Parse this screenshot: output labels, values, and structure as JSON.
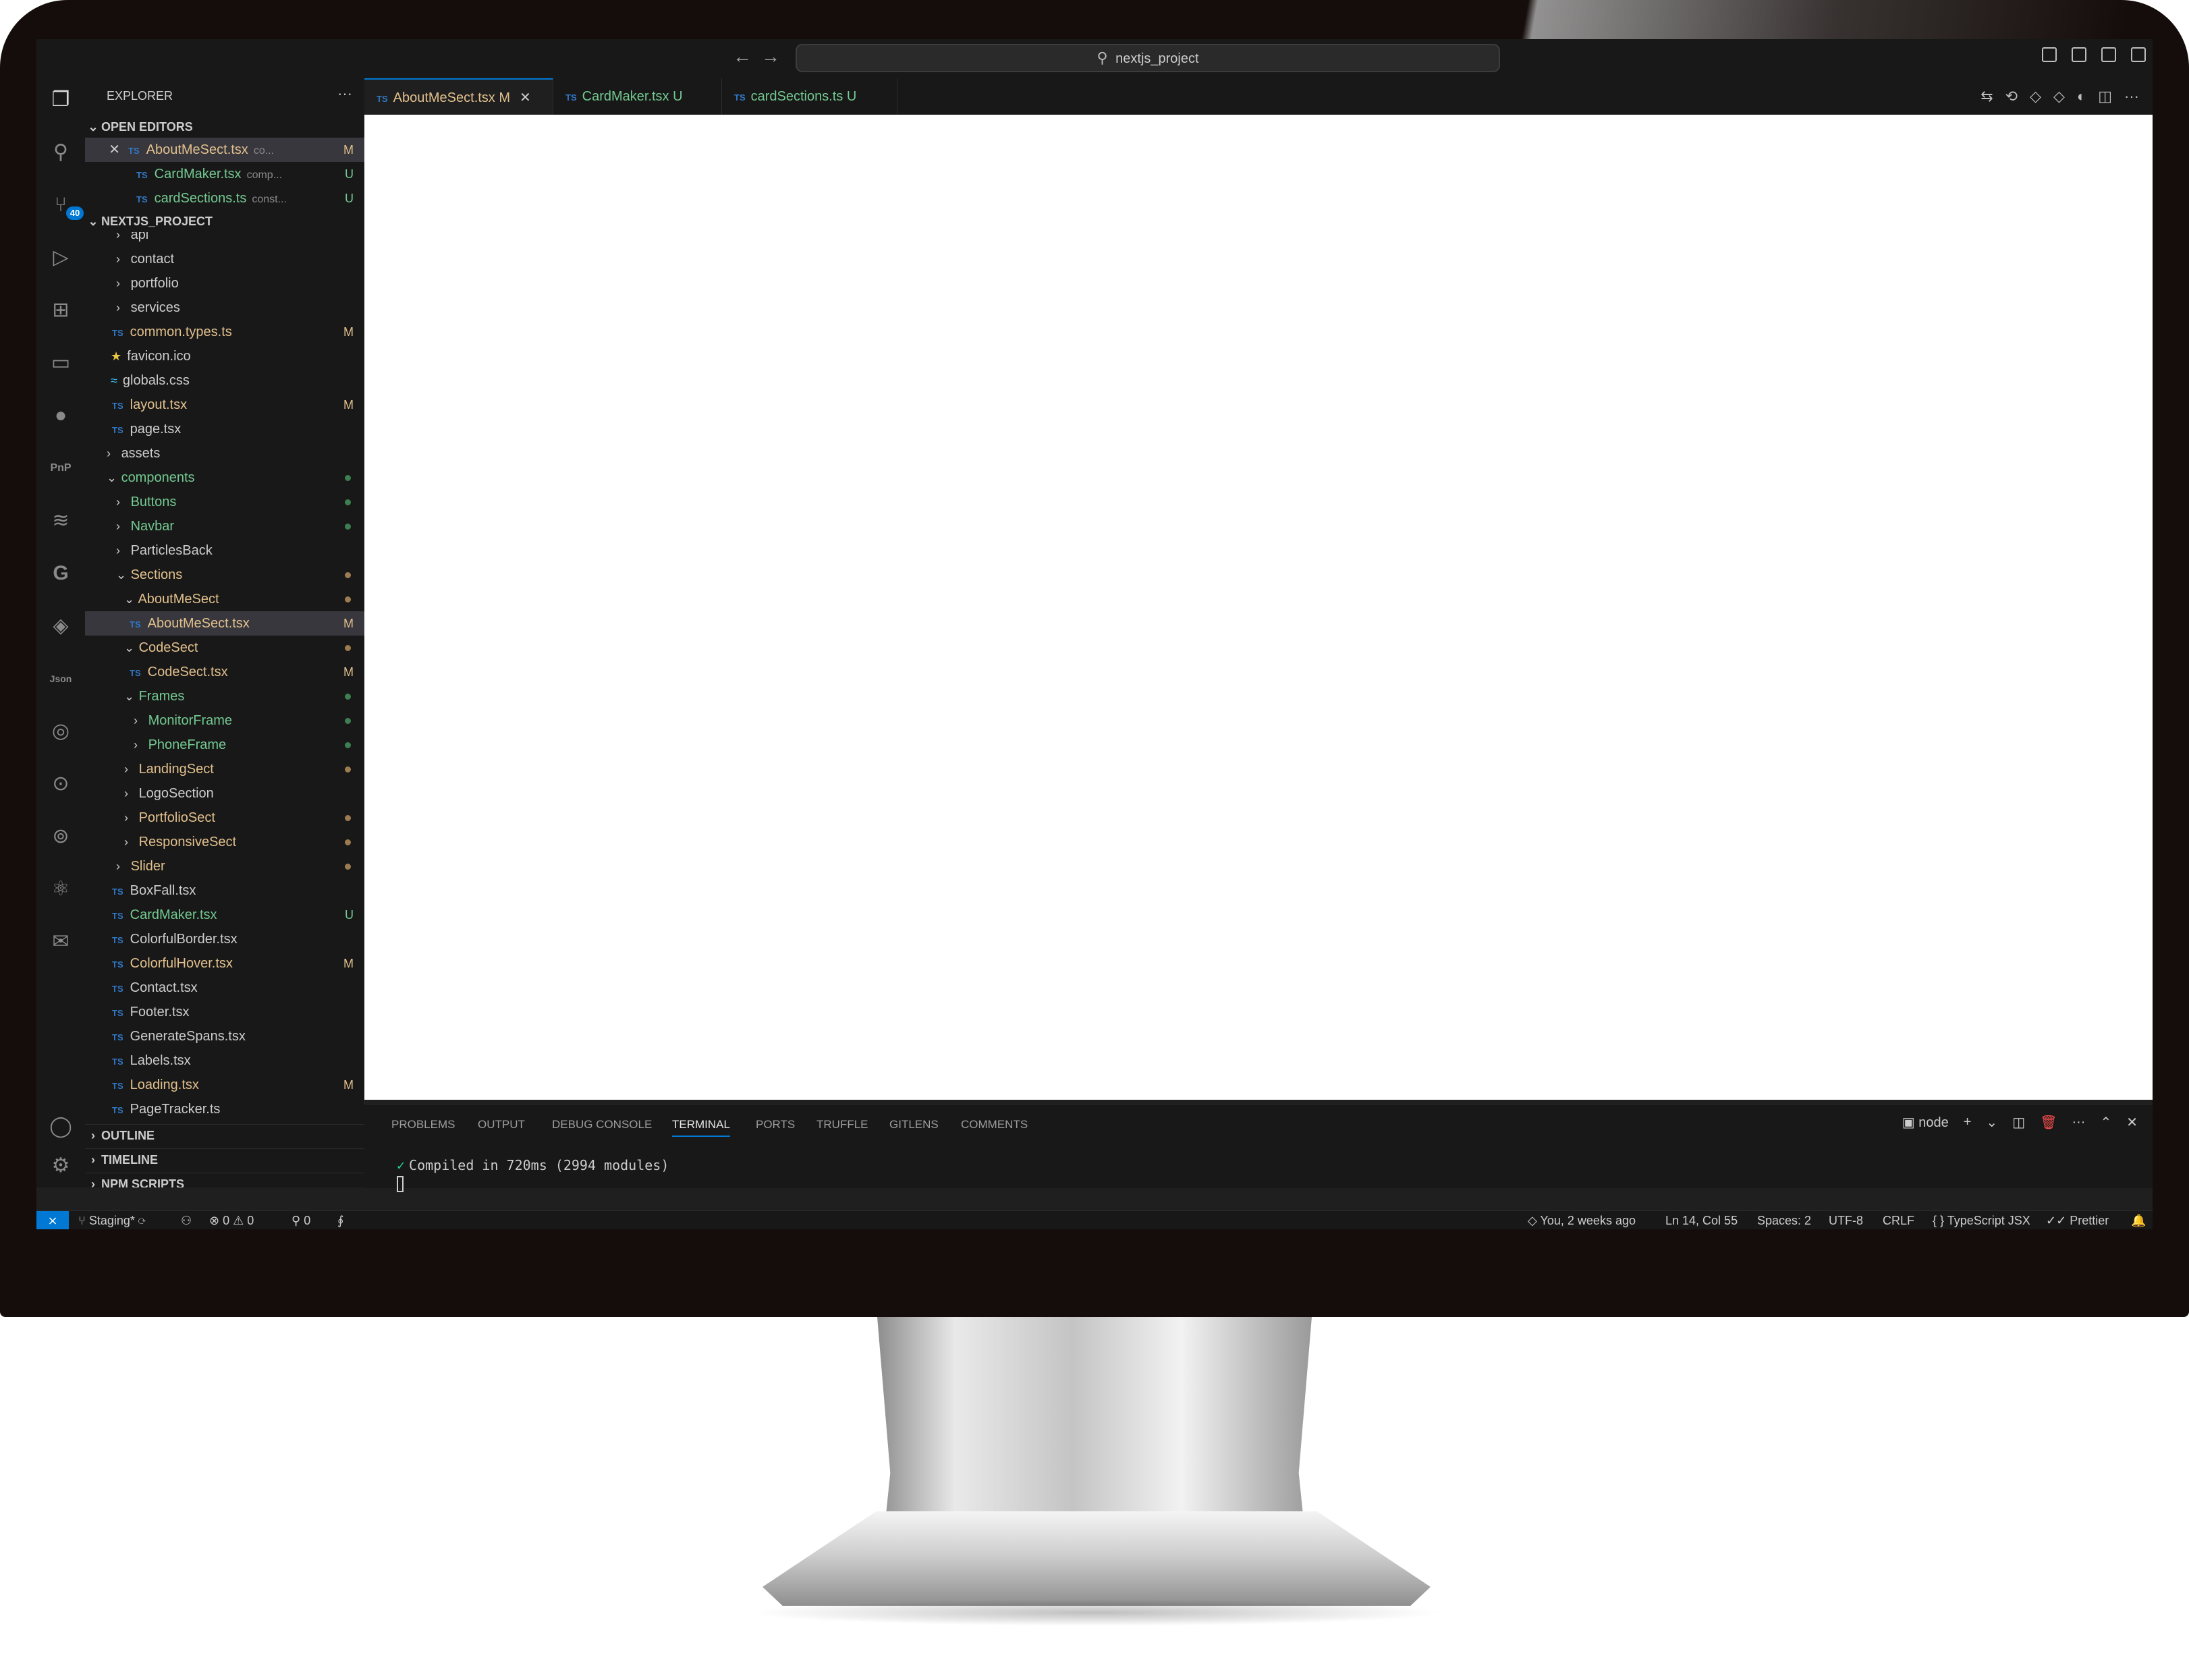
{
  "titlebar": {
    "search_text": "nextjs_project",
    "back": "←",
    "forward": "→"
  },
  "activity": {
    "scm_badge": "40"
  },
  "explorer": {
    "title": "EXPLORER",
    "more": "···",
    "open_editors_label": "OPEN EDITORS",
    "open_editors": [
      {
        "name": "AboutMeSect.tsx",
        "desc": "co...",
        "status": "M"
      },
      {
        "name": "CardMaker.tsx",
        "desc": "comp...",
        "status": "U"
      },
      {
        "name": "cardSections.ts",
        "desc": "const...",
        "status": "U"
      }
    ],
    "project_label": "NEXTJS_PROJECT",
    "tree": [
      {
        "label": "api"
      },
      {
        "label": "contact"
      },
      {
        "label": "portfolio"
      },
      {
        "label": "services"
      },
      {
        "label": "common.types.ts",
        "status": "M"
      },
      {
        "label": "favicon.ico"
      },
      {
        "label": "globals.css"
      },
      {
        "label": "layout.tsx",
        "status": "M"
      },
      {
        "label": "page.tsx"
      },
      {
        "label": "assets"
      },
      {
        "label": "components"
      },
      {
        "label": "Buttons"
      },
      {
        "label": "Navbar"
      },
      {
        "label": "ParticlesBack"
      },
      {
        "label": "Sections"
      },
      {
        "label": "AboutMeSect"
      },
      {
        "label": "AboutMeSect.tsx",
        "status": "M"
      },
      {
        "label": "CodeSect"
      },
      {
        "label": "CodeSect.tsx",
        "status": "M"
      },
      {
        "label": "Frames"
      },
      {
        "label": "MonitorFrame"
      },
      {
        "label": "PhoneFrame"
      },
      {
        "label": "LandingSect"
      },
      {
        "label": "LogoSection"
      },
      {
        "label": "PortfolioSect"
      },
      {
        "label": "ResponsiveSect"
      },
      {
        "label": "Slider"
      },
      {
        "label": "BoxFall.tsx"
      },
      {
        "label": "CardMaker.tsx",
        "status": "U"
      },
      {
        "label": "ColorfulBorder.tsx"
      },
      {
        "label": "ColorfulHover.tsx",
        "status": "M"
      },
      {
        "label": "Contact.tsx"
      },
      {
        "label": "Footer.tsx"
      },
      {
        "label": "GenerateSpans.tsx"
      },
      {
        "label": "Labels.tsx"
      },
      {
        "label": "Loading.tsx",
        "status": "M"
      },
      {
        "label": "PageTracker.ts"
      }
    ],
    "outline_label": "OUTLINE",
    "timeline_label": "TIMELINE",
    "npm_label": "NPM SCRIPTS"
  },
  "tabs": [
    {
      "name": "AboutMeSect.tsx",
      "status": "M",
      "close": "✕"
    },
    {
      "name": "CardMaker.tsx",
      "status": "U"
    },
    {
      "name": "cardSections.ts",
      "status": "U"
    }
  ],
  "panel": {
    "tabs": [
      "PROBLEMS",
      "OUTPUT",
      "DEBUG CONSOLE",
      "TERMINAL",
      "PORTS",
      "TRUFFLE",
      "GITLENS",
      "COMMENTS"
    ],
    "active_tab": "TERMINAL",
    "shell": "node",
    "terminal_line": "Compiled in 720ms (2994 modules)"
  },
  "statusbar": {
    "branch": "Staging*",
    "errors": "0",
    "warnings": "0",
    "ports": "0",
    "blame": "You, 2 weeks ago",
    "position": "Ln 14, Col 55",
    "spaces": "Spaces: 2",
    "encoding": "UTF-8",
    "eol": "CRLF",
    "language": "TypeScript JSX",
    "formatter": "Prettier"
  },
  "colors": {
    "accent": "#0078d4",
    "modified": "#e2c08d",
    "untracked": "#73c991",
    "ts_icon": "#3178c6"
  }
}
